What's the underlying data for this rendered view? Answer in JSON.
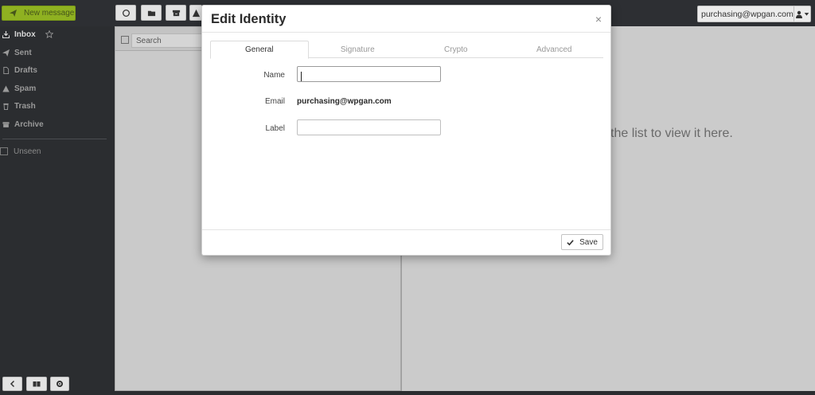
{
  "toolbar": {
    "new_message_label": "New message"
  },
  "account": {
    "email": "purchasing@wpgan.com"
  },
  "sidebar": {
    "folders": [
      {
        "label": "Inbox",
        "icon": "inbox-icon"
      },
      {
        "label": "Sent",
        "icon": "send-icon"
      },
      {
        "label": "Drafts",
        "icon": "file-icon"
      },
      {
        "label": "Spam",
        "icon": "warning-icon"
      },
      {
        "label": "Trash",
        "icon": "trash-icon"
      },
      {
        "label": "Archive",
        "icon": "archive-icon"
      }
    ],
    "unseen_label": "Unseen"
  },
  "message_list": {
    "search_placeholder": "Search"
  },
  "preview": {
    "hint": "the list to view it here."
  },
  "modal": {
    "title": "Edit Identity",
    "close_glyph": "×",
    "tabs": [
      {
        "label": "General",
        "active": true
      },
      {
        "label": "Signature",
        "active": false
      },
      {
        "label": "Crypto",
        "active": false
      },
      {
        "label": "Advanced",
        "active": false
      }
    ],
    "fields": {
      "name_label": "Name",
      "name_value": "",
      "email_label": "Email",
      "email_value": "purchasing@wpgan.com",
      "label_label": "Label",
      "label_value": ""
    },
    "save_label": "Save"
  },
  "colors": {
    "accent_green": "#8fb121",
    "sidebar_bg": "#2b2d30",
    "overlay_gray": "#cbcbcb"
  }
}
